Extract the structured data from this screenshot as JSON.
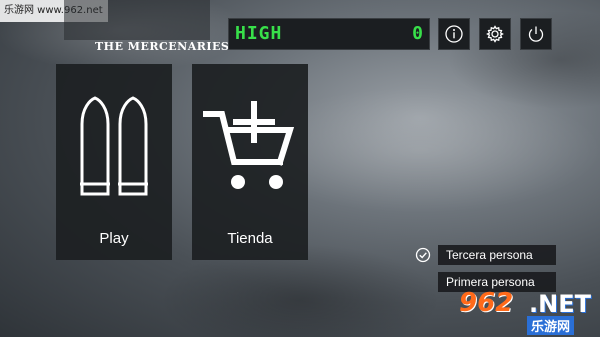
{
  "watermark_top": "乐游网 www.962.net",
  "game_title": "THE MERCENARIES",
  "high_score": {
    "label": "HIGH",
    "value": "0"
  },
  "top_buttons": {
    "info_icon": "info-icon",
    "settings_icon": "gear-icon",
    "power_icon": "power-icon"
  },
  "tiles": [
    {
      "label": "Play",
      "icon": "bullets-icon"
    },
    {
      "label": "Tienda",
      "icon": "cart-add-icon"
    }
  ],
  "camera_options": [
    {
      "label": "Tercera persona",
      "selected": true
    },
    {
      "label": "Primera persona",
      "selected": false
    }
  ],
  "watermark_bottom": {
    "number": "962",
    "suffix": ".NET",
    "site": "乐游网"
  },
  "colors": {
    "accent_green": "#38e04a",
    "tile_bg": "#1c1f22",
    "watermark_orange": "#ff6a1a"
  }
}
